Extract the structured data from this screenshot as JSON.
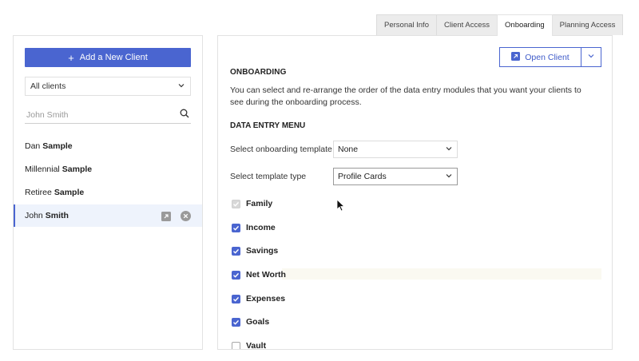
{
  "tabs": [
    {
      "label": "Personal Info",
      "active": false
    },
    {
      "label": "Client Access",
      "active": false
    },
    {
      "label": "Onboarding",
      "active": true
    },
    {
      "label": "Planning Access",
      "active": false
    }
  ],
  "sidebar": {
    "add_button_label": "Add a New Client",
    "filter_value": "All clients",
    "search_placeholder": "John Smith",
    "clients": [
      {
        "first": "Dan",
        "last": "Sample"
      },
      {
        "first": "Millennial",
        "last": "Sample"
      },
      {
        "first": "Retiree",
        "last": "Sample"
      },
      {
        "first": "John",
        "last": "Smith",
        "selected": true
      }
    ]
  },
  "main": {
    "open_client_label": "Open Client",
    "section_title": "ONBOARDING",
    "description": "You can select and re-arrange the order of the data entry modules that you want your clients to see during the onboarding process.",
    "menu_title": "DATA ENTRY MENU",
    "template_label": "Select onboarding template",
    "template_value": "None",
    "type_label": "Select template type",
    "type_value": "Profile Cards",
    "modules": [
      {
        "label": "Family",
        "state": "disabled-checked"
      },
      {
        "label": "Income",
        "state": "checked"
      },
      {
        "label": "Savings",
        "state": "checked"
      },
      {
        "label": "Net Worth",
        "state": "checked"
      },
      {
        "label": "Expenses",
        "state": "checked"
      },
      {
        "label": "Goals",
        "state": "checked"
      },
      {
        "label": "Vault",
        "state": "unchecked"
      }
    ]
  },
  "colors": {
    "accent": "#4a65d0",
    "selected_row": "#eef3fc",
    "tab_bg": "#ececec"
  },
  "icons": [
    "plus-icon",
    "chevron-down-icon",
    "search-icon",
    "open-external-icon",
    "remove-icon",
    "checkmark-icon",
    "mouse-pointer-icon"
  ]
}
